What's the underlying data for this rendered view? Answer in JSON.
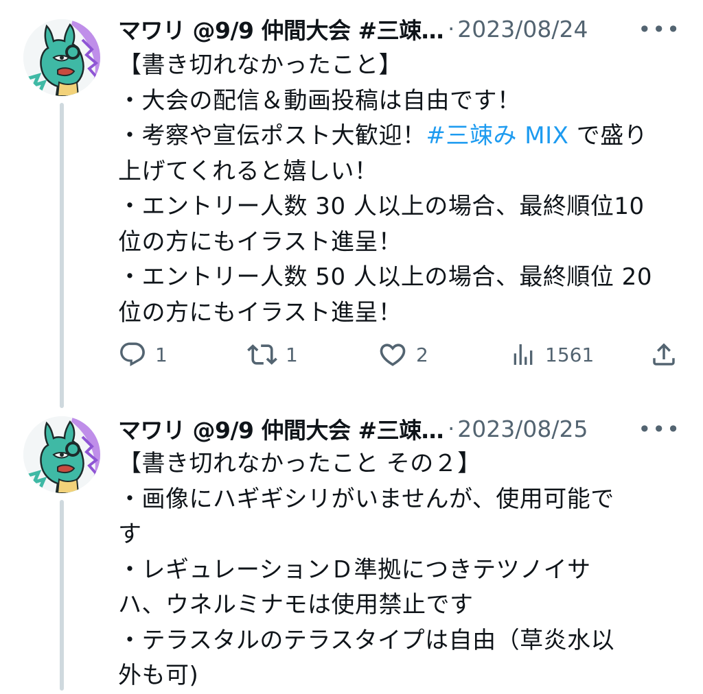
{
  "tweets": [
    {
      "author": "マワリ @9/9 仲間大会 #三竦…",
      "separator": "·",
      "date": "2023/08/24",
      "more": "•••",
      "lines": [
        "【書き切れなかったこと】",
        "・大会の配信＆動画投稿は自由です！",
        "・考察や宣伝ポスト大歓迎！",
        "上げてくれると嬉しい！",
        "・エントリー人数 30 人以上の場合、最終順位10",
        "位の方にもイラスト進呈！",
        "・エントリー人数 50 人以上の場合、最終順位 20",
        "位の方にもイラスト進呈！"
      ],
      "hashtag": "#三竦み MIX",
      "after_hashtag": " で盛り",
      "stats": {
        "replies": "1",
        "reposts": "1",
        "likes": "2",
        "views": "1561"
      }
    },
    {
      "author": "マワリ @9/9 仲間大会 #三竦…",
      "separator": "·",
      "date": "2023/08/25",
      "more": "•••",
      "lines": [
        "【書き切れなかったこと その２】",
        "・画像にハギギシリがいませんが、使用可能で",
        "す",
        "・レギュレーションＤ準拠につきテツノイサ",
        "ハ、ウネルミナモは使用禁止です",
        "・テラスタルのテラスタイプは自由（草炎水以",
        "外も可)"
      ]
    }
  ],
  "icons": {
    "reply": "reply-icon",
    "repost": "repost-icon",
    "like": "heart-icon",
    "views": "views-icon",
    "share": "share-icon"
  },
  "colors": {
    "hashtag": "#1d9bf0",
    "secondary_text": "#536471",
    "thread_line": "#cfd9de",
    "avatar_teal": "#3fb9a5",
    "avatar_purple": "#a97be0"
  }
}
